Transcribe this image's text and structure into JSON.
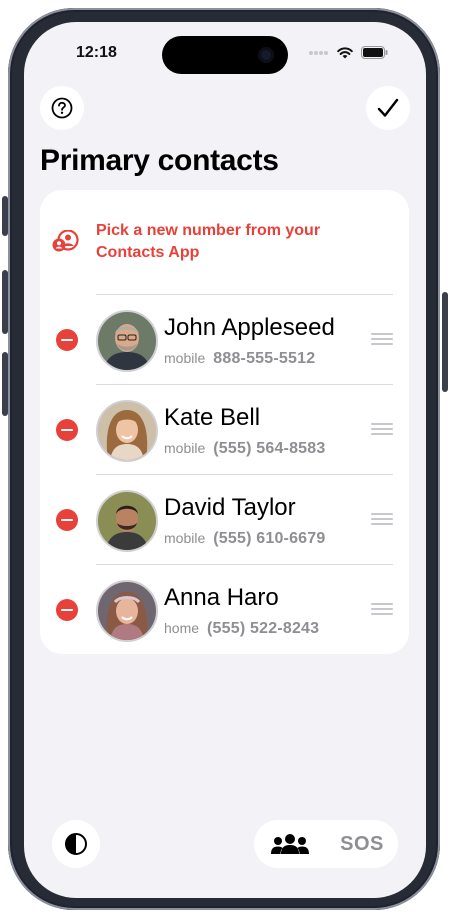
{
  "status_bar": {
    "time": "12:18"
  },
  "header": {
    "help_icon": "question-circle-icon",
    "done_icon": "checkmark-icon"
  },
  "page": {
    "title": "Primary contacts"
  },
  "pick_contact": {
    "icon": "contacts-app-icon",
    "label": "Pick a new number from your Contacts App"
  },
  "contacts": [
    {
      "name": "John Appleseed",
      "label": "mobile",
      "phone": "888-555-5512"
    },
    {
      "name": "Kate Bell",
      "label": "mobile",
      "phone": "(555) 564-8583"
    },
    {
      "name": "David Taylor",
      "label": "mobile",
      "phone": "(555) 610-6679"
    },
    {
      "name": "Anna Haro",
      "label": "home",
      "phone": "(555) 522-8243"
    }
  ],
  "bottom_bar": {
    "theme_icon": "contrast-icon",
    "segments": {
      "contacts_icon": "people-icon",
      "sos_label": "SOS"
    }
  },
  "colors": {
    "accent_red": "#e8413a",
    "background": "#f2f2f7",
    "card": "#ffffff",
    "secondary_text": "#8e8e93"
  }
}
